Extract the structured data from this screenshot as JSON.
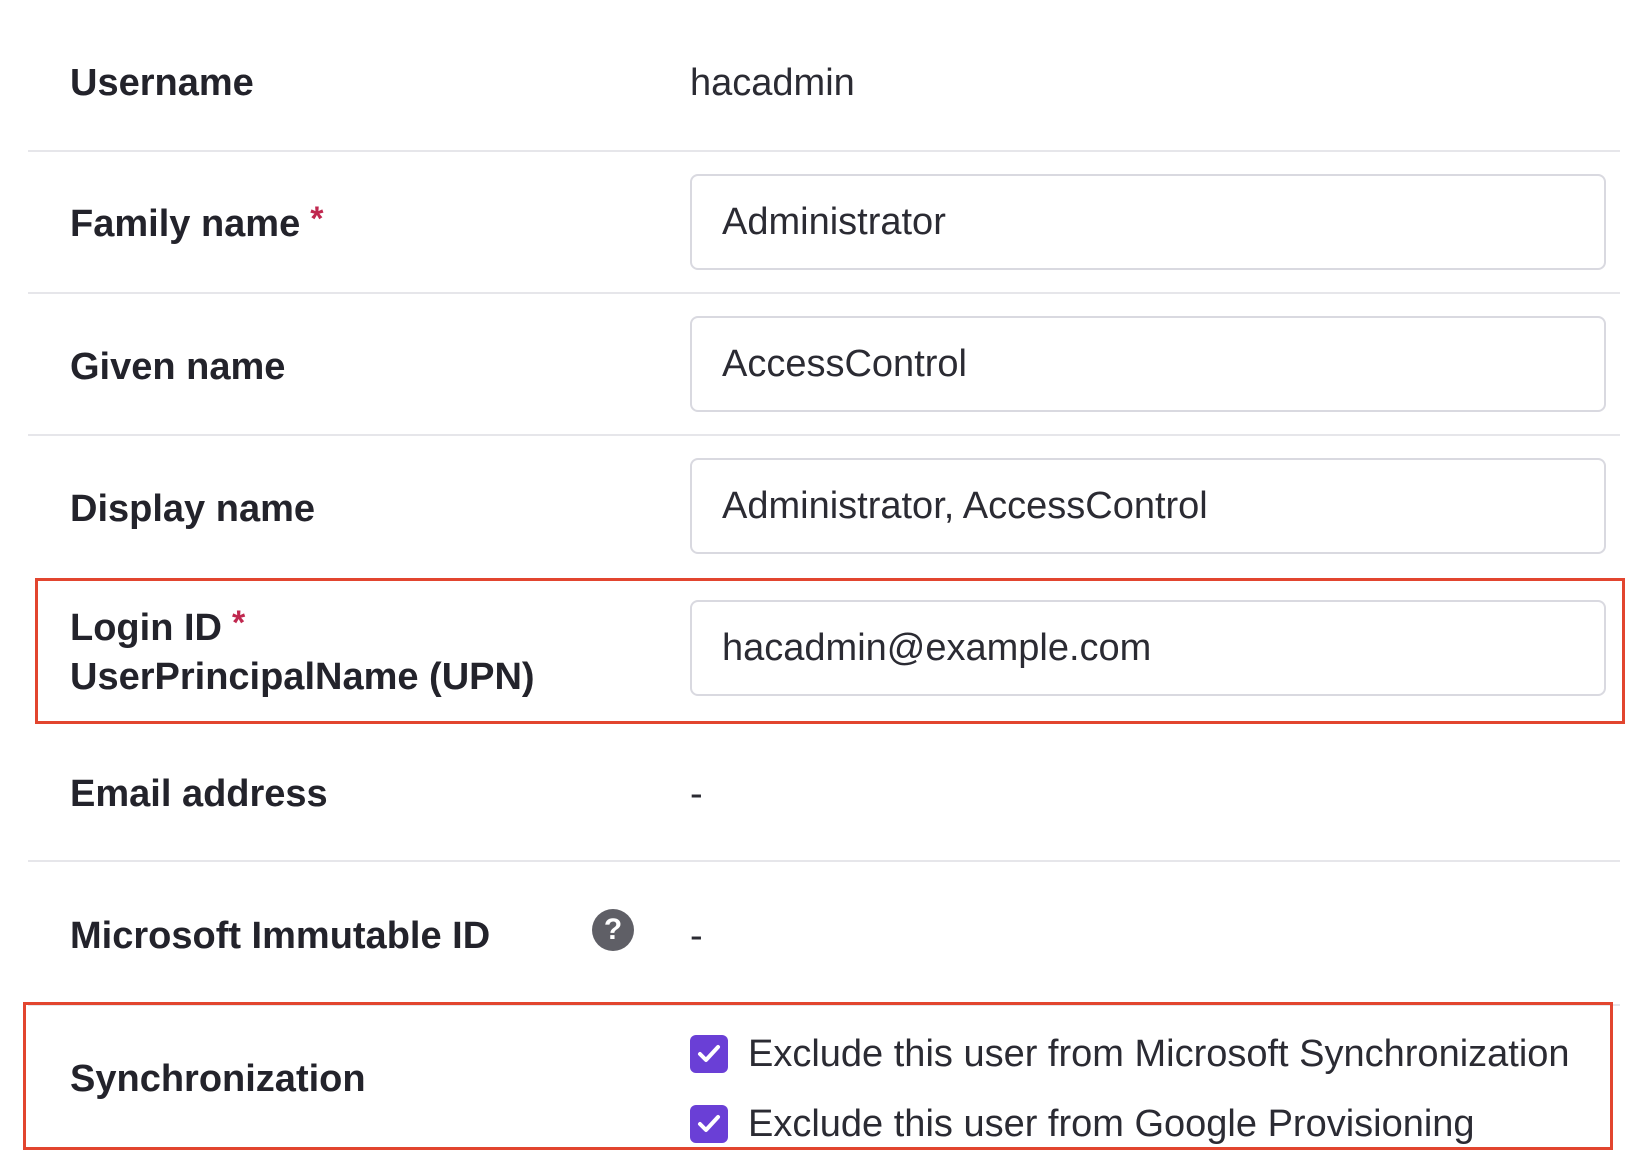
{
  "username": {
    "label": "Username",
    "value": "hacadmin"
  },
  "family_name": {
    "label": "Family name",
    "required_mark": "*",
    "value": "Administrator"
  },
  "given_name": {
    "label": "Given name",
    "value": "AccessControl"
  },
  "display_name": {
    "label": "Display name",
    "value": "Administrator, AccessControl"
  },
  "login_id": {
    "label": "Login ID",
    "required_mark": "*",
    "sublabel": "UserPrincipalName (UPN)",
    "value": "hacadmin@example.com"
  },
  "email": {
    "label": "Email address",
    "value": "-"
  },
  "immutable_id": {
    "label": "Microsoft Immutable ID",
    "help_icon": "question-circle-icon",
    "help_glyph": "?",
    "value": "-"
  },
  "synchronization": {
    "label": "Synchronization",
    "options": [
      {
        "label": "Exclude this user from Microsoft Synchronization",
        "checked": true
      },
      {
        "label": "Exclude this user from Google Provisioning",
        "checked": true
      }
    ]
  },
  "colors": {
    "accent": "#6a3fd6",
    "highlight": "#e2452f",
    "required": "#c0284f"
  }
}
